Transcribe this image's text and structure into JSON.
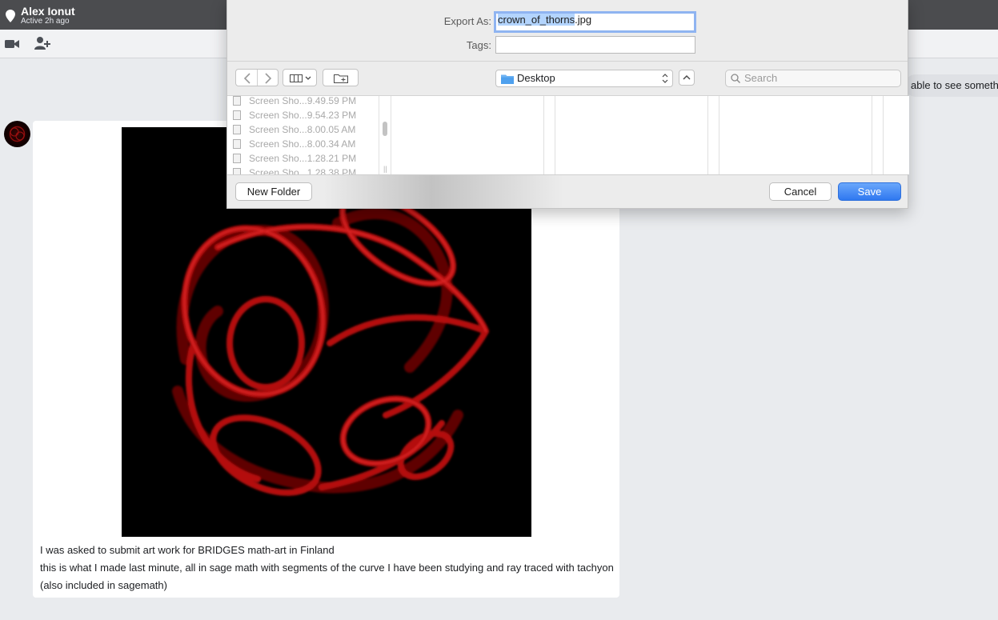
{
  "chat": {
    "contact_name": "Alex Ionut",
    "status": "Active 2h ago",
    "icons": [
      "location-pin-icon",
      "video-call-icon",
      "add-person-icon"
    ],
    "partial_message": "able to see someth",
    "message": {
      "line1": "I was asked to submit art work for BRIDGES math-art in Finland",
      "line2": "this is what I made last minute, all in sage math with segments of the curve I have been studying and ray traced with tachyon (also included in sagemath)"
    }
  },
  "dialog": {
    "export_as_label": "Export As:",
    "filename_selected": "crown_of_thorns",
    "filename_ext": ".jpg",
    "tags_label": "Tags:",
    "tags_value": "",
    "location": "Desktop",
    "search_placeholder": "Search",
    "files": [
      {
        "name": "Screen Sho...9.49.59 PM"
      },
      {
        "name": "Screen Sho...9.54.23 PM"
      },
      {
        "name": "Screen Sho...8.00.05 AM"
      },
      {
        "name": "Screen Sho...8.00.34 AM"
      },
      {
        "name": "Screen Sho...1.28.21 PM"
      },
      {
        "name": "Screen Sho...1.28.38 PM"
      }
    ],
    "new_folder_label": "New Folder",
    "cancel_label": "Cancel",
    "save_label": "Save"
  },
  "colors": {
    "header_bg": "#4b4c4f",
    "save_button": "#2f78f0",
    "artwork_red": "#b40f0f"
  }
}
